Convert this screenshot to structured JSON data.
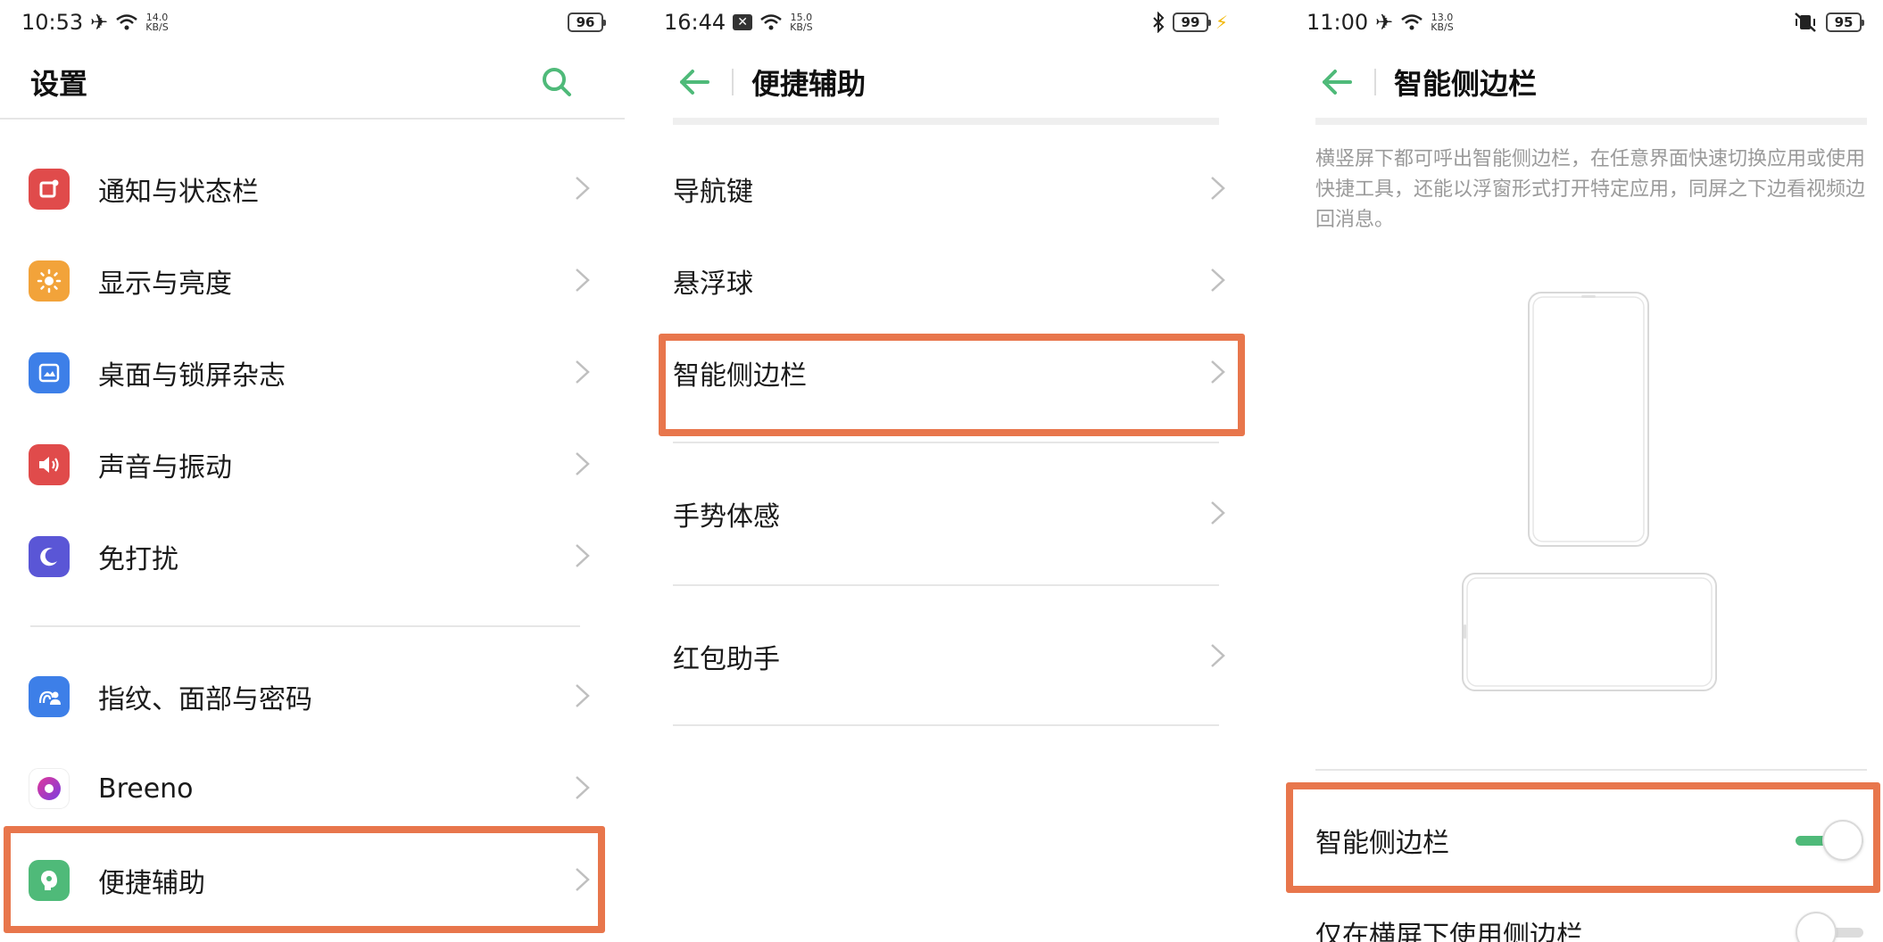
{
  "colors": {
    "accent": "#4fba79",
    "highlight": "#e8764c",
    "chevron": "#bfbfbf"
  },
  "panel1": {
    "status": {
      "time": "10:53",
      "kbs_value": "14.0",
      "kbs_unit": "KB/S",
      "battery": "96"
    },
    "title": "设置",
    "items": [
      {
        "label": "通知与状态栏",
        "icon": "notification-icon",
        "color": "#e04b4b"
      },
      {
        "label": "显示与亮度",
        "icon": "sun-icon",
        "color": "#f2a33a"
      },
      {
        "label": "桌面与锁屏杂志",
        "icon": "wallpaper-icon",
        "color": "#3d7fe8"
      },
      {
        "label": "声音与振动",
        "icon": "speaker-icon",
        "color": "#e04b4b"
      },
      {
        "label": "免打扰",
        "icon": "moon-icon",
        "color": "#5a56d6"
      },
      {
        "label": "指纹、面部与密码",
        "icon": "fingerprint-icon",
        "color": "#3d7fe8"
      },
      {
        "label": "Breeno",
        "icon": "breeno-icon",
        "color": "#c73aa8"
      },
      {
        "label": "便捷辅助",
        "icon": "assist-icon",
        "color": "#4fba79"
      }
    ]
  },
  "panel2": {
    "status": {
      "time": "16:44",
      "kbs_value": "15.0",
      "kbs_unit": "KB/S",
      "battery": "99"
    },
    "title": "便捷辅助",
    "items": [
      {
        "label": "导航键"
      },
      {
        "label": "悬浮球"
      },
      {
        "label": "智能侧边栏"
      },
      {
        "label": "手势体感"
      },
      {
        "label": "红包助手"
      }
    ]
  },
  "panel3": {
    "status": {
      "time": "11:00",
      "kbs_value": "13.0",
      "kbs_unit": "KB/S",
      "battery": "95"
    },
    "title": "智能侧边栏",
    "description": "横竖屏下都可呼出智能侧边栏，在任意界面快速切换应用或使用快捷工具，还能以浮窗形式打开特定应用，同屏之下边看视频边回消息。",
    "toggles": [
      {
        "label": "智能侧边栏",
        "on": true
      },
      {
        "label": "仅在横屏下使用侧边栏",
        "on": false
      }
    ]
  }
}
